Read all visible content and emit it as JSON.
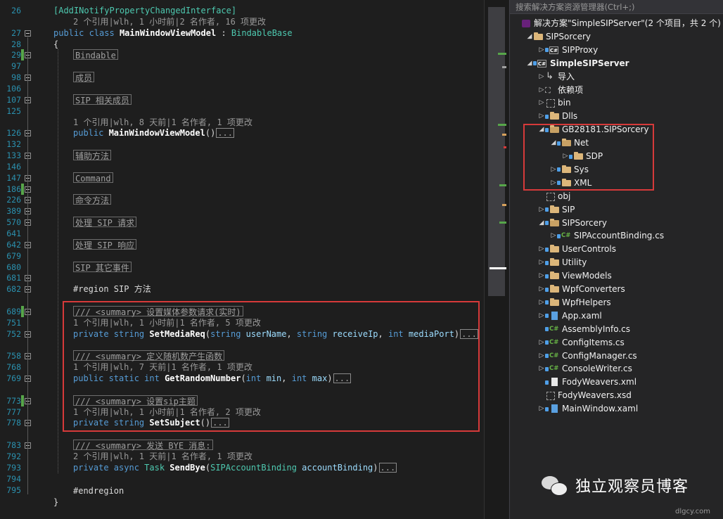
{
  "editor": {
    "line_numbers": [
      "26",
      "",
      "27",
      "28",
      "29",
      "97",
      "98",
      "106",
      "107",
      "125",
      "",
      "126",
      "132",
      "133",
      "146",
      "147",
      "186",
      "226",
      "389",
      "570",
      "641",
      "642",
      "679",
      "680",
      "681",
      "682",
      "",
      "689",
      "751",
      "752",
      "",
      "758",
      "768",
      "769",
      "",
      "773",
      "777",
      "778",
      "",
      "783",
      "792",
      "793",
      "794",
      "795"
    ],
    "attribute": "[AddINotifyPropertyChangedInterface]",
    "lens_class": "2 个引用|wlh, 1 小时前|2 名作者, 16 项更改",
    "class_decl": {
      "kw1": "public",
      "kw2": "class",
      "name": "MainWindowViewModel",
      "sep": " : ",
      "base": "BindableBase"
    },
    "open_brace": "{",
    "regions": [
      "Bindable",
      "成员",
      "SIP 相关成员"
    ],
    "ctor_lens": "1 个引用|wlh, 8 天前|1 名作者, 1 项更改",
    "ctor": {
      "kw": "public",
      "name": "MainWindowViewModel",
      "paren": "()",
      "ellipsis": "..."
    },
    "regions2": [
      "辅助方法",
      "Command",
      "命令方法",
      "处理 SIP 请求",
      "处理 SIP 响应",
      "SIP 其它事件"
    ],
    "region_directive": "#region SIP 方法",
    "methods": [
      {
        "summary": "/// <summary> 设置媒体参数请求(实时)",
        "lens": "1 个引用|wlh, 1 小时前|1 名作者, 5 项更改",
        "kw1": "private",
        "kw2": "string",
        "name": "SetMediaReq",
        "params": [
          [
            "string",
            "userName"
          ],
          [
            "string",
            "receiveIp"
          ],
          [
            "int",
            "mediaPort"
          ]
        ]
      },
      {
        "summary": "/// <summary> 定义随机数产生函数",
        "lens": "1 个引用|wlh, 7 天前|1 名作者, 1 项更改",
        "kw1": "public",
        "kw2": "static",
        "kw3": "int",
        "name": "GetRandomNumber",
        "params": [
          [
            "int",
            "min"
          ],
          [
            "int",
            "max"
          ]
        ]
      },
      {
        "summary": "/// <summary> 设置sip主题",
        "lens": "1 个引用|wlh, 1 小时前|1 名作者, 2 项更改",
        "kw1": "private",
        "kw2": "string",
        "name": "SetSubject",
        "params": []
      },
      {
        "summary": "/// <summary> 发送 BYE 消息:",
        "lens": "2 个引用|wlh, 1 天前|1 名作者, 1 项更改",
        "kw1": "private",
        "kw2": "async",
        "type": "Task",
        "name": "SendBye",
        "params": [
          [
            "SIPAccountBinding",
            "accountBinding"
          ]
        ]
      }
    ],
    "endregion": "#endregion",
    "close_brace": "}",
    "ellipsis": "..."
  },
  "solution_explorer": {
    "search_placeholder": "搜索解决方案资源管理器(Ctrl+;)",
    "items": [
      {
        "label": "解决方案\"SimpleSIPServer\"(2 个项目，共 2 个)",
        "icon": "solution-icon",
        "expanded": null
      },
      {
        "label": "SIPSorcery",
        "icon": "folder-icon",
        "expanded": true
      },
      {
        "label": "SIPProxy",
        "icon": "csharp-project-icon",
        "expanded": false
      },
      {
        "label": "SimpleSIPServer",
        "icon": "csharp-project-icon",
        "expanded": true,
        "bold": true
      },
      {
        "label": "导入",
        "icon": "import-icon",
        "expanded": false
      },
      {
        "label": "依赖项",
        "icon": "dependencies-icon",
        "expanded": false
      },
      {
        "label": "bin",
        "icon": "hidden-folder-icon",
        "expanded": false
      },
      {
        "label": "Dlls",
        "icon": "folder-icon",
        "expanded": false
      },
      {
        "label": "GB28181.SIPSorcery",
        "icon": "folder-open-icon",
        "expanded": true
      },
      {
        "label": "Net",
        "icon": "folder-open-icon",
        "expanded": true
      },
      {
        "label": "SDP",
        "icon": "folder-icon",
        "expanded": false
      },
      {
        "label": "Sys",
        "icon": "folder-icon",
        "expanded": false
      },
      {
        "label": "XML",
        "icon": "folder-icon",
        "expanded": false
      },
      {
        "label": "obj",
        "icon": "hidden-folder-icon",
        "expanded": null
      },
      {
        "label": "SIP",
        "icon": "folder-icon",
        "expanded": false
      },
      {
        "label": "SIPSorcery",
        "icon": "folder-open-icon",
        "expanded": true
      },
      {
        "label": "SIPAccountBinding.cs",
        "icon": "csharp-file-icon",
        "expanded": false
      },
      {
        "label": "UserControls",
        "icon": "folder-icon",
        "expanded": false
      },
      {
        "label": "Utility",
        "icon": "folder-icon",
        "expanded": false
      },
      {
        "label": "ViewModels",
        "icon": "folder-icon",
        "expanded": false
      },
      {
        "label": "WpfConverters",
        "icon": "folder-icon",
        "expanded": false
      },
      {
        "label": "WpfHelpers",
        "icon": "folder-icon",
        "expanded": false
      },
      {
        "label": "App.xaml",
        "icon": "xaml-file-icon",
        "expanded": false
      },
      {
        "label": "AssemblyInfo.cs",
        "icon": "csharp-file-icon",
        "expanded": null
      },
      {
        "label": "ConfigItems.cs",
        "icon": "csharp-file-icon",
        "expanded": false
      },
      {
        "label": "ConfigManager.cs",
        "icon": "csharp-file-icon",
        "expanded": false
      },
      {
        "label": "ConsoleWriter.cs",
        "icon": "csharp-file-icon",
        "expanded": false
      },
      {
        "label": "FodyWeavers.xml",
        "icon": "xml-file-icon",
        "expanded": null
      },
      {
        "label": "FodyWeavers.xsd",
        "icon": "dashed-file-icon",
        "expanded": null
      },
      {
        "label": "MainWindow.xaml",
        "icon": "xaml-file-icon",
        "expanded": false
      }
    ]
  },
  "watermark": {
    "text": "独立观察员博客",
    "url": "dlgcy.com"
  },
  "colors": {
    "highlight_box": "#d63a3a",
    "keyword": "#569cd6",
    "type": "#4ec9b0",
    "line_number": "#2b91af"
  }
}
